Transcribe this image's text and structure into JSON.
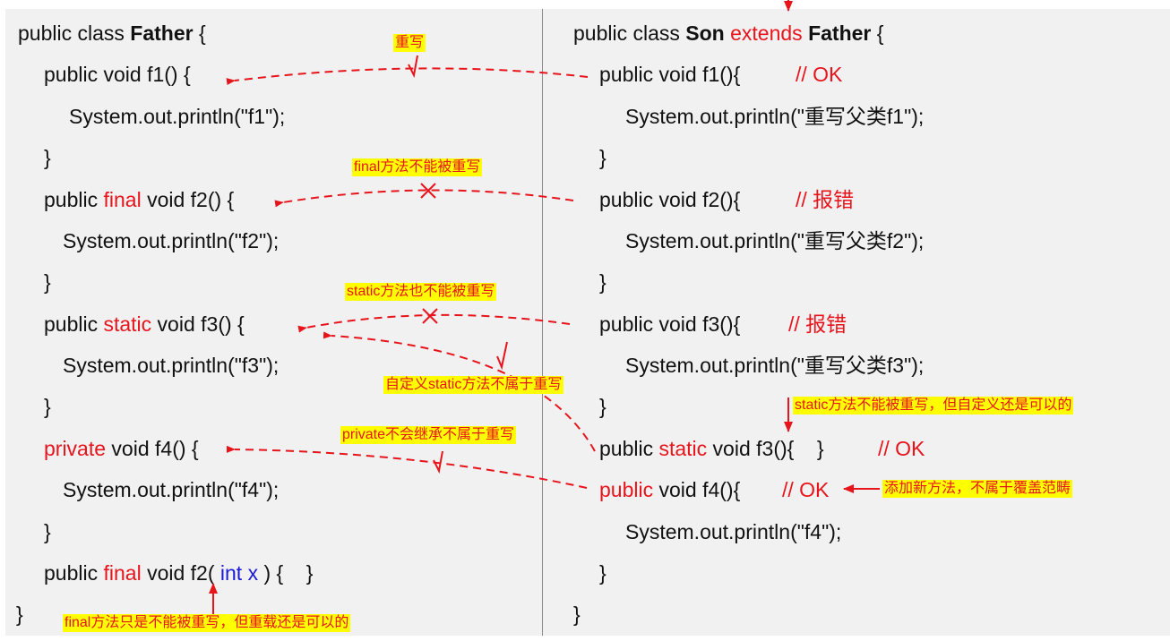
{
  "father": {
    "class_decl": {
      "prefix": "public class ",
      "name": "Father",
      "suffix": " {"
    },
    "f1": {
      "sig": "public void f1() {",
      "body": "System.out.println(\"f1\");",
      "close": "}"
    },
    "f2": {
      "pre": "public ",
      "kw": "final",
      "post": " void f2() {",
      "body": "System.out.println(\"f2\");",
      "close": "}"
    },
    "f3": {
      "pre": "public ",
      "kw": "static",
      "post": " void f3() {",
      "body": "System.out.println(\"f3\");",
      "close": "}"
    },
    "f4": {
      "kw": "private",
      "post": " void f4() {",
      "body": "System.out.println(\"f4\");",
      "close": "}"
    },
    "f2_overload": {
      "pre": "public ",
      "kw": "final",
      "mid": " void f2( ",
      "param": "int x",
      "post": " ) {    }"
    },
    "class_close": "}"
  },
  "son": {
    "class_decl": {
      "prefix": "public class ",
      "name": "Son",
      "ext": " extends ",
      "parent": "Father",
      "suffix": " {"
    },
    "f1": {
      "sig": "public void f1(){",
      "comment": "// OK",
      "body": "System.out.println(\"重写父类f1\");",
      "close": "}"
    },
    "f2": {
      "sig": "public void f2(){",
      "comment": "// 报错",
      "body": "System.out.println(\"重写父类f2\");",
      "close": "}"
    },
    "f3": {
      "sig": "public void f3(){",
      "comment": "// 报错",
      "body": "System.out.println(\"重写父类f3\");",
      "close": "}"
    },
    "f3_static": {
      "pre": "public ",
      "kw": "static",
      "post": " void f3(){    }",
      "comment": "// OK"
    },
    "f4": {
      "kw": "public",
      "post": " void f4(){",
      "comment": "// OK",
      "body": "System.out.println(\"f4\");",
      "close": "}"
    },
    "class_close": "}"
  },
  "annotations": {
    "override": "重写",
    "final_no_override": "final方法不能被重写",
    "static_no_override": "static方法也不能被重写",
    "custom_static": "自定义static方法不属于重写",
    "private_no_inherit": "private不会继承不属于重写",
    "static_custom_ok": "static方法不能被重写，但自定义还是可以的",
    "new_method": "添加新方法，不属于覆盖范畴",
    "final_overload_ok": "final方法只是不能被重写，但重载还是可以的",
    "check_mark": "√",
    "cross_mark": "✕"
  },
  "colors": {
    "accent_red": "#e8141c",
    "highlight_yellow": "#ffff00",
    "param_blue": "#1a1ad8",
    "panel_bg": "#f1f1f1"
  }
}
